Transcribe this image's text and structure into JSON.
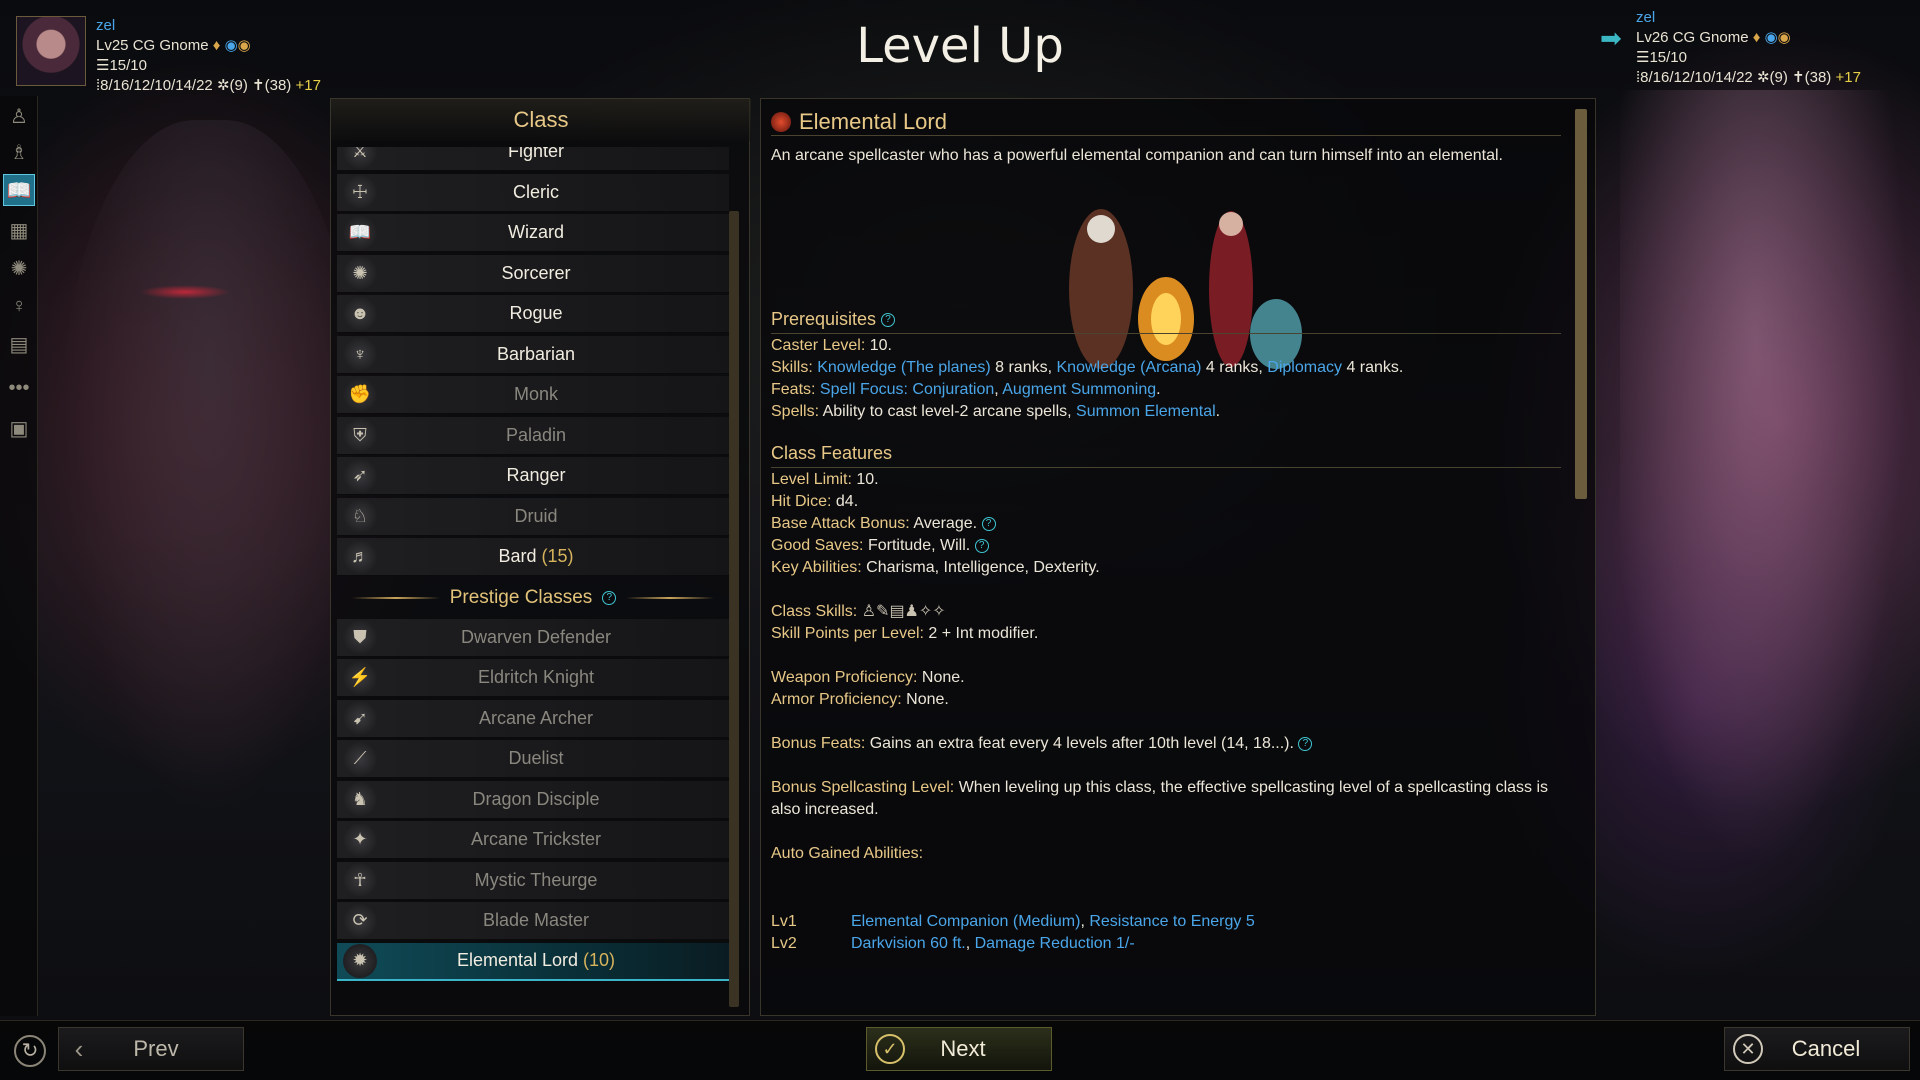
{
  "title": "Level Up",
  "current": {
    "name": "zel",
    "line": "Lv25 CG Gnome",
    "health": "15/10",
    "stats": "8/16/12/10/14/22",
    "s1": "(9)",
    "s2": "(38)",
    "bonus": "+17"
  },
  "next": {
    "name": "zel",
    "line": "Lv26 CG Gnome",
    "health": "15/10",
    "stats": "8/16/12/10/14/22",
    "s1": "(9)",
    "s2": "(38)",
    "bonus": "+17"
  },
  "class_panel": {
    "title": "Class",
    "classes": [
      {
        "label": "Fighter",
        "icon": "fighter-icon",
        "dim": false
      },
      {
        "label": "Cleric",
        "icon": "cleric-icon",
        "dim": false
      },
      {
        "label": "Wizard",
        "icon": "wizard-icon",
        "dim": false
      },
      {
        "label": "Sorcerer",
        "icon": "sorcerer-icon",
        "dim": false
      },
      {
        "label": "Rogue",
        "icon": "rogue-icon",
        "dim": false
      },
      {
        "label": "Barbarian",
        "icon": "barbarian-icon",
        "dim": false
      },
      {
        "label": "Monk",
        "icon": "monk-icon",
        "dim": true
      },
      {
        "label": "Paladin",
        "icon": "paladin-icon",
        "dim": true
      },
      {
        "label": "Ranger",
        "icon": "ranger-icon",
        "dim": false
      },
      {
        "label": "Druid",
        "icon": "druid-icon",
        "dim": true
      },
      {
        "label": "Bard",
        "level": "(15)",
        "icon": "bard-icon",
        "dim": false
      }
    ],
    "prestige_title": "Prestige Classes",
    "prestige": [
      {
        "label": "Dwarven Defender",
        "icon": "dwarven-defender-icon",
        "dim": true
      },
      {
        "label": "Eldritch Knight",
        "icon": "eldritch-knight-icon",
        "dim": true
      },
      {
        "label": "Arcane Archer",
        "icon": "arcane-archer-icon",
        "dim": true
      },
      {
        "label": "Duelist",
        "icon": "duelist-icon",
        "dim": true
      },
      {
        "label": "Dragon Disciple",
        "icon": "dragon-disciple-icon",
        "dim": true
      },
      {
        "label": "Arcane Trickster",
        "icon": "arcane-trickster-icon",
        "dim": true
      },
      {
        "label": "Mystic Theurge",
        "icon": "mystic-theurge-icon",
        "dim": true
      },
      {
        "label": "Blade Master",
        "icon": "blade-master-icon",
        "dim": true
      },
      {
        "label": "Elemental Lord",
        "level": "(10)",
        "icon": "elemental-lord-icon",
        "dim": false,
        "selected": true
      }
    ]
  },
  "detail": {
    "title": "Elemental Lord",
    "description": "An arcane spellcaster who has a powerful elemental companion and can turn himself into an elemental.",
    "prereq_title": "Prerequisites",
    "caster_level": {
      "k": "Caster Level:",
      "v": "10."
    },
    "skills": {
      "k": "Skills:",
      "s1": "Knowledge (The planes)",
      "r1": "8 ranks,",
      "s2": "Knowledge (Arcana)",
      "r2": "4 ranks,",
      "s3": "Diplomacy",
      "r3": "4 ranks."
    },
    "feats": {
      "k": "Feats:",
      "f1": "Spell Focus: Conjuration",
      "f2": "Augment Summoning"
    },
    "spells": {
      "k": "Spells:",
      "v": "Ability to cast level-2 arcane spells,",
      "link": "Summon Elemental"
    },
    "features_title": "Class Features",
    "level_limit": {
      "k": "Level Limit:",
      "v": "10."
    },
    "hit_dice": {
      "k": "Hit Dice:",
      "v": "d4."
    },
    "bab": {
      "k": "Base Attack Bonus:",
      "v": "Average."
    },
    "saves": {
      "k": "Good Saves:",
      "v": "Fortitude, Will."
    },
    "key_abilities": {
      "k": "Key Abilities:",
      "v": "Charisma, Intelligence, Dexterity."
    },
    "class_skills": {
      "k": "Class Skills:"
    },
    "skill_points": {
      "k": "Skill Points per Level:",
      "v": "2 + Int modifier."
    },
    "weapon_prof": {
      "k": "Weapon Proficiency:",
      "v": "None."
    },
    "armor_prof": {
      "k": "Armor Proficiency:",
      "v": "None."
    },
    "bonus_feats": {
      "k": "Bonus Feats:",
      "v": "Gains an extra feat every 4 levels after 10th level (14, 18...)."
    },
    "bonus_spell": {
      "k": "Bonus Spellcasting Level:",
      "v": "When leveling up this class, the effective spellcasting level of a spellcasting class is also increased."
    },
    "auto_title": "Auto Gained Abilities:",
    "abilities": [
      {
        "lv": "Lv1",
        "a1": "Elemental Companion (Medium)",
        "a2": "Resistance to Energy 5"
      },
      {
        "lv": "Lv2",
        "a1": "Darkvision 60 ft.",
        "a2": "Damage Reduction 1/-"
      }
    ]
  },
  "buttons": {
    "prev": "Prev",
    "next": "Next",
    "cancel": "Cancel"
  },
  "colors": {
    "gold": "#e8c887",
    "link": "#4aa6e8",
    "accent": "#3bb5c9"
  }
}
